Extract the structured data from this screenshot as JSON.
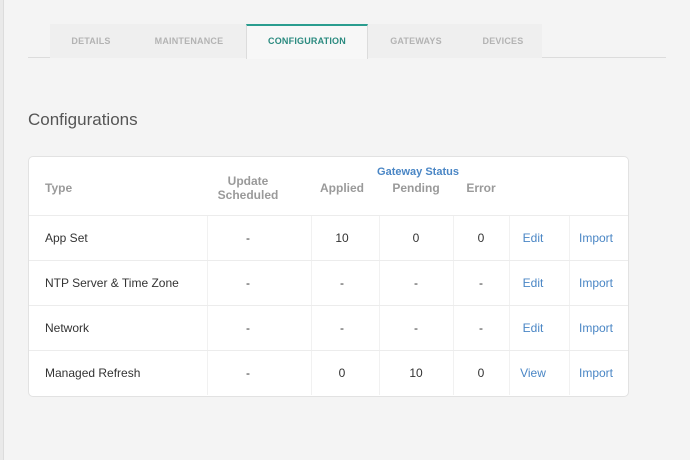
{
  "tabs": [
    {
      "label": "DETAILS",
      "active": false
    },
    {
      "label": "MAINTENANCE",
      "active": false
    },
    {
      "label": "CONFIGURATION",
      "active": true
    },
    {
      "label": "GATEWAYS",
      "active": false
    },
    {
      "label": "DEVICES",
      "active": false
    }
  ],
  "section_title": "Configurations",
  "table": {
    "headers": {
      "type": "Type",
      "update_scheduled_line1": "Update",
      "update_scheduled_line2": "Scheduled",
      "applied": "Applied",
      "gateway_status": "Gateway Status",
      "pending": "Pending",
      "error": "Error"
    },
    "rows": [
      {
        "type": "App Set",
        "update": "-",
        "applied": "10",
        "pending": "0",
        "error": "0",
        "action": "Edit",
        "import": "Import"
      },
      {
        "type": "NTP Server & Time Zone",
        "update": "-",
        "applied": "-",
        "pending": "-",
        "error": "-",
        "action": "Edit",
        "import": "Import"
      },
      {
        "type": "Network",
        "update": "-",
        "applied": "-",
        "pending": "-",
        "error": "-",
        "action": "Edit",
        "import": "Import"
      },
      {
        "type": "Managed Refresh",
        "update": "-",
        "applied": "0",
        "pending": "10",
        "error": "0",
        "action": "View",
        "import": "Import"
      }
    ]
  },
  "colors": {
    "accent_teal": "#2a8a7f",
    "link_blue": "#4a86c5"
  }
}
